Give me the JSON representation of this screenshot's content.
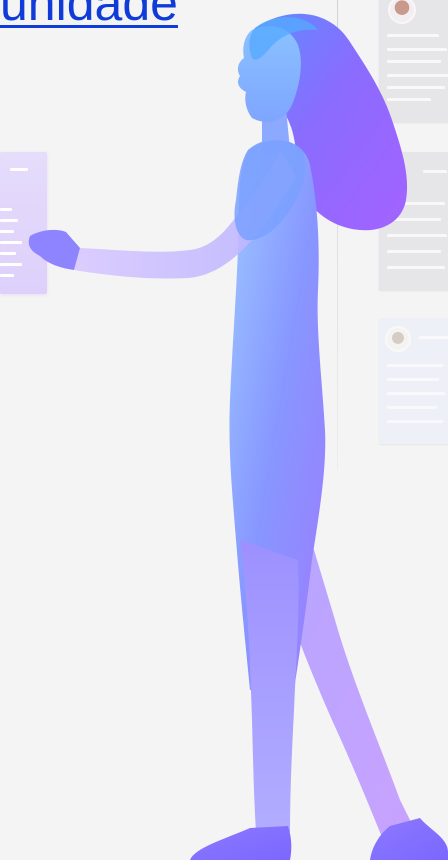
{
  "header": {
    "link_text": "unidade"
  },
  "illustration": {
    "subject": "woman-holding-document-icon",
    "colors": {
      "background": "#f4f4f4",
      "link": "#0f3bd8",
      "figure_light": "#9ec8ff",
      "figure_mid": "#7f8cff",
      "figure_dark": "#a36cff",
      "card": "#e6e6e8",
      "document": "#e3d8fb"
    }
  },
  "cards": [
    {
      "avatar_icon": "avatar-icon"
    },
    {
      "avatar_icon": "avatar-icon"
    },
    {
      "avatar_icon": "avatar-icon"
    }
  ]
}
